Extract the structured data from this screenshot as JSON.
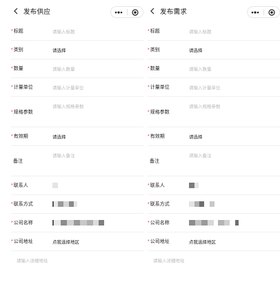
{
  "left": {
    "title": "发布供应",
    "fields": [
      {
        "label": "标题",
        "value": "请输入标题"
      },
      {
        "label": "类别",
        "value": "请选择"
      },
      {
        "label": "数量",
        "value": "请输入数量"
      },
      {
        "label": "计量单位",
        "value": "请输入计量单位"
      },
      {
        "label": "规格参数",
        "value": "请输入规格参数"
      },
      {
        "label": "有效期",
        "value": "请选择"
      },
      {
        "label": "备注",
        "value": "请输入备注"
      },
      {
        "label": "联系人"
      },
      {
        "label": "联系方式"
      },
      {
        "label": "公司名称"
      },
      {
        "label": "公司地址",
        "value": "点我选择地区"
      }
    ],
    "detail_placeholder": "请输入详细地址"
  },
  "right": {
    "title": "发布需求",
    "fields": [
      {
        "label": "标题",
        "value": "请输入标题"
      },
      {
        "label": "类别",
        "value": "请选择"
      },
      {
        "label": "数量",
        "value": "请输入数量"
      },
      {
        "label": "计量单位",
        "value": "请输入计量单位"
      },
      {
        "label": "规格参数",
        "value": "请输入规格参数"
      },
      {
        "label": "有效期",
        "value": "请选择"
      },
      {
        "label": "备注",
        "value": "请输入备注"
      },
      {
        "label": "联系人"
      },
      {
        "label": "联系方式"
      },
      {
        "label": "公司名称"
      },
      {
        "label": "公司地址",
        "value": "点我选择地区"
      }
    ],
    "detail_placeholder": "请输入详细地址"
  },
  "required_mark": "*",
  "icons": {
    "back": "chevron-left-icon",
    "more": "more-dots-icon",
    "close": "target-close-icon"
  },
  "colors": {
    "required": "#e23b3b",
    "placeholder": "#b9b9b9",
    "text": "#222222",
    "divider": "#f0f0f0"
  }
}
